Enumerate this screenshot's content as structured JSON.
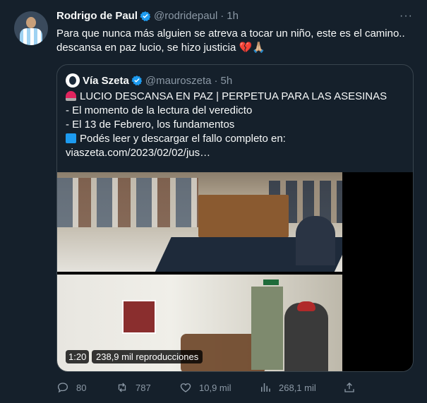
{
  "tweet": {
    "author_name": "Rodrigo de Paul",
    "author_handle": "@rodridepaul",
    "separator": "·",
    "time": "1h",
    "more_label": "···",
    "text_line1": "Para que nunca más alguien se atreva a tocar un niño, este es el camino..",
    "text_line2": "descansa en paz lucio, se hizo justicia",
    "text_emojis": "💔🙏🏼"
  },
  "quote": {
    "author_name": "Vía Szeta",
    "author_handle": "@mauroszeta",
    "time": "5h",
    "line1": "LUCIO DESCANSA EN PAZ | PERPETUA PARA LAS ASESINAS",
    "line2": "- El momento de la lectura del veredicto",
    "line3": "- El 13 de Febrero, los fundamentos",
    "line4": "Podés leer y descargar el fallo completo en:",
    "line5": "viaszeta.com/2023/02/02/jus…",
    "video_time": "1:20",
    "video_views": "238,9 mil reproducciones"
  },
  "actions": {
    "replies": "80",
    "retweets": "787",
    "likes": "10,9 mil",
    "views": "268,1 mil"
  },
  "colors": {
    "background": "#15202b",
    "text": "#f7f9f9",
    "muted": "#8b98a5",
    "verified": "#1d9bf0",
    "border": "#38444d"
  },
  "icons": [
    "verified-badge-icon",
    "more-icon",
    "reply-icon",
    "retweet-icon",
    "like-icon",
    "views-icon",
    "share-icon"
  ]
}
